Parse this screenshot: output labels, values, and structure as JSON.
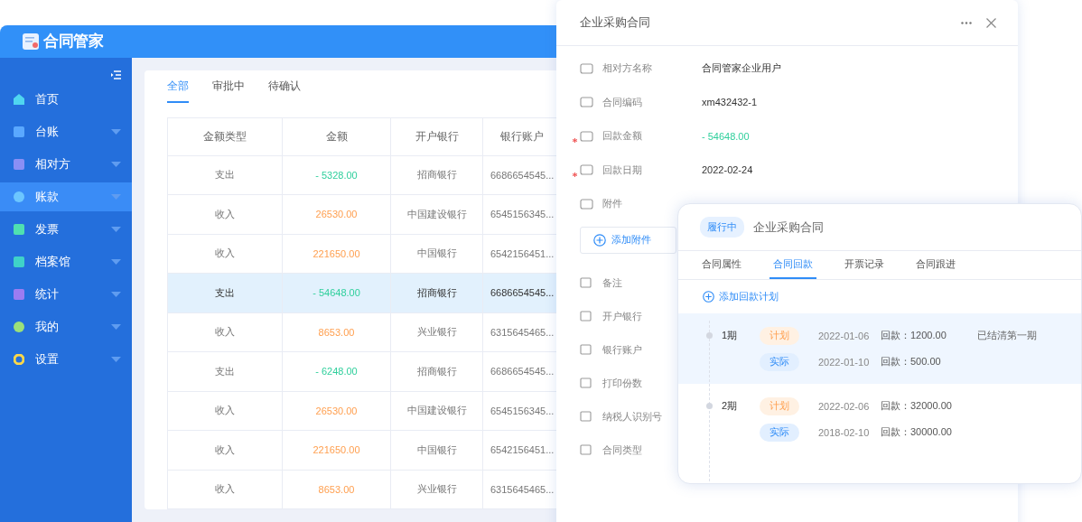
{
  "app": {
    "logo": "合同管家",
    "sidebar": [
      {
        "label": "首页",
        "expandable": false,
        "selected": false
      },
      {
        "label": "台账",
        "expandable": true,
        "selected": false
      },
      {
        "label": "相对方",
        "expandable": true,
        "selected": false
      },
      {
        "label": "账款",
        "expandable": true,
        "selected": true
      },
      {
        "label": "发票",
        "expandable": true,
        "selected": false
      },
      {
        "label": "档案馆",
        "expandable": true,
        "selected": false
      },
      {
        "label": "统计",
        "expandable": true,
        "selected": false
      },
      {
        "label": "我的",
        "expandable": true,
        "selected": false
      },
      {
        "label": "设置",
        "expandable": true,
        "selected": false
      }
    ],
    "tabs": [
      {
        "label": "全部",
        "selected": true
      },
      {
        "label": "审批中",
        "selected": false
      },
      {
        "label": "待确认",
        "selected": false
      }
    ],
    "table": {
      "columns": [
        "金额类型",
        "金额",
        "开户银行",
        "银行账户"
      ],
      "rows": [
        {
          "type": "支出",
          "amount": "- 5328.00",
          "kind": "expense",
          "bank": "招商银行",
          "account": "6686654545...",
          "selected": false
        },
        {
          "type": "收入",
          "amount": "26530.00",
          "kind": "income",
          "bank": "中国建设银行",
          "account": "6545156345...",
          "selected": false
        },
        {
          "type": "收入",
          "amount": "221650.00",
          "kind": "income",
          "bank": "中国银行",
          "account": "6542156451...",
          "selected": false
        },
        {
          "type": "支出",
          "amount": "- 54648.00",
          "kind": "expense",
          "bank": "招商银行",
          "account": "6686654545...",
          "selected": true
        },
        {
          "type": "收入",
          "amount": "8653.00",
          "kind": "income",
          "bank": "兴业银行",
          "account": "6315645465...",
          "selected": false
        },
        {
          "type": "支出",
          "amount": "- 6248.00",
          "kind": "expense",
          "bank": "招商银行",
          "account": "6686654545...",
          "selected": false
        },
        {
          "type": "收入",
          "amount": "26530.00",
          "kind": "income",
          "bank": "中国建设银行",
          "account": "6545156345...",
          "selected": false
        },
        {
          "type": "收入",
          "amount": "221650.00",
          "kind": "income",
          "bank": "中国银行",
          "account": "6542156451...",
          "selected": false
        },
        {
          "type": "收入",
          "amount": "8653.00",
          "kind": "income",
          "bank": "兴业银行",
          "account": "6315645465...",
          "selected": false
        }
      ]
    }
  },
  "detail": {
    "title": "企业采购合同",
    "fields": [
      {
        "label": "相对方名称",
        "value": "合同管家企业用户",
        "kind": "text",
        "required": false
      },
      {
        "label": "合同编码",
        "value": "xm432432-1",
        "kind": "text",
        "required": false
      },
      {
        "label": "回款金额",
        "value": "- 54648.00",
        "kind": "amount",
        "required": true
      },
      {
        "label": "回款日期",
        "value": "2022-02-24",
        "kind": "text",
        "required": true
      },
      {
        "label": "附件",
        "required": false
      }
    ],
    "attach_button": "添加附件",
    "more_fields": [
      "备注",
      "开户银行",
      "银行账户",
      "打印份数",
      "纳税人识别号",
      "合同类型"
    ]
  },
  "card": {
    "status": "履行中",
    "title": "企业采购合同",
    "tabs": [
      {
        "label": "合同属性",
        "selected": false
      },
      {
        "label": "合同回款",
        "selected": true
      },
      {
        "label": "开票记录",
        "selected": false
      },
      {
        "label": "合同跟进",
        "selected": false
      }
    ],
    "add_plan": "添加回款计划",
    "periods": [
      {
        "label": "1期",
        "highlighted": true,
        "entries": [
          {
            "tag": "计划",
            "kind": "plan",
            "date": "2022-01-06",
            "amount": "回款：1200.00",
            "note": "已结清第一期"
          },
          {
            "tag": "实际",
            "kind": "actual",
            "date": "2022-01-10",
            "amount": "回款：500.00"
          }
        ]
      },
      {
        "label": "2期",
        "highlighted": false,
        "entries": [
          {
            "tag": "计划",
            "kind": "plan",
            "date": "2022-02-06",
            "amount": "回款：32000.00"
          },
          {
            "tag": "实际",
            "kind": "actual",
            "date": "2018-02-10",
            "amount": "回款：30000.00"
          }
        ]
      }
    ]
  }
}
